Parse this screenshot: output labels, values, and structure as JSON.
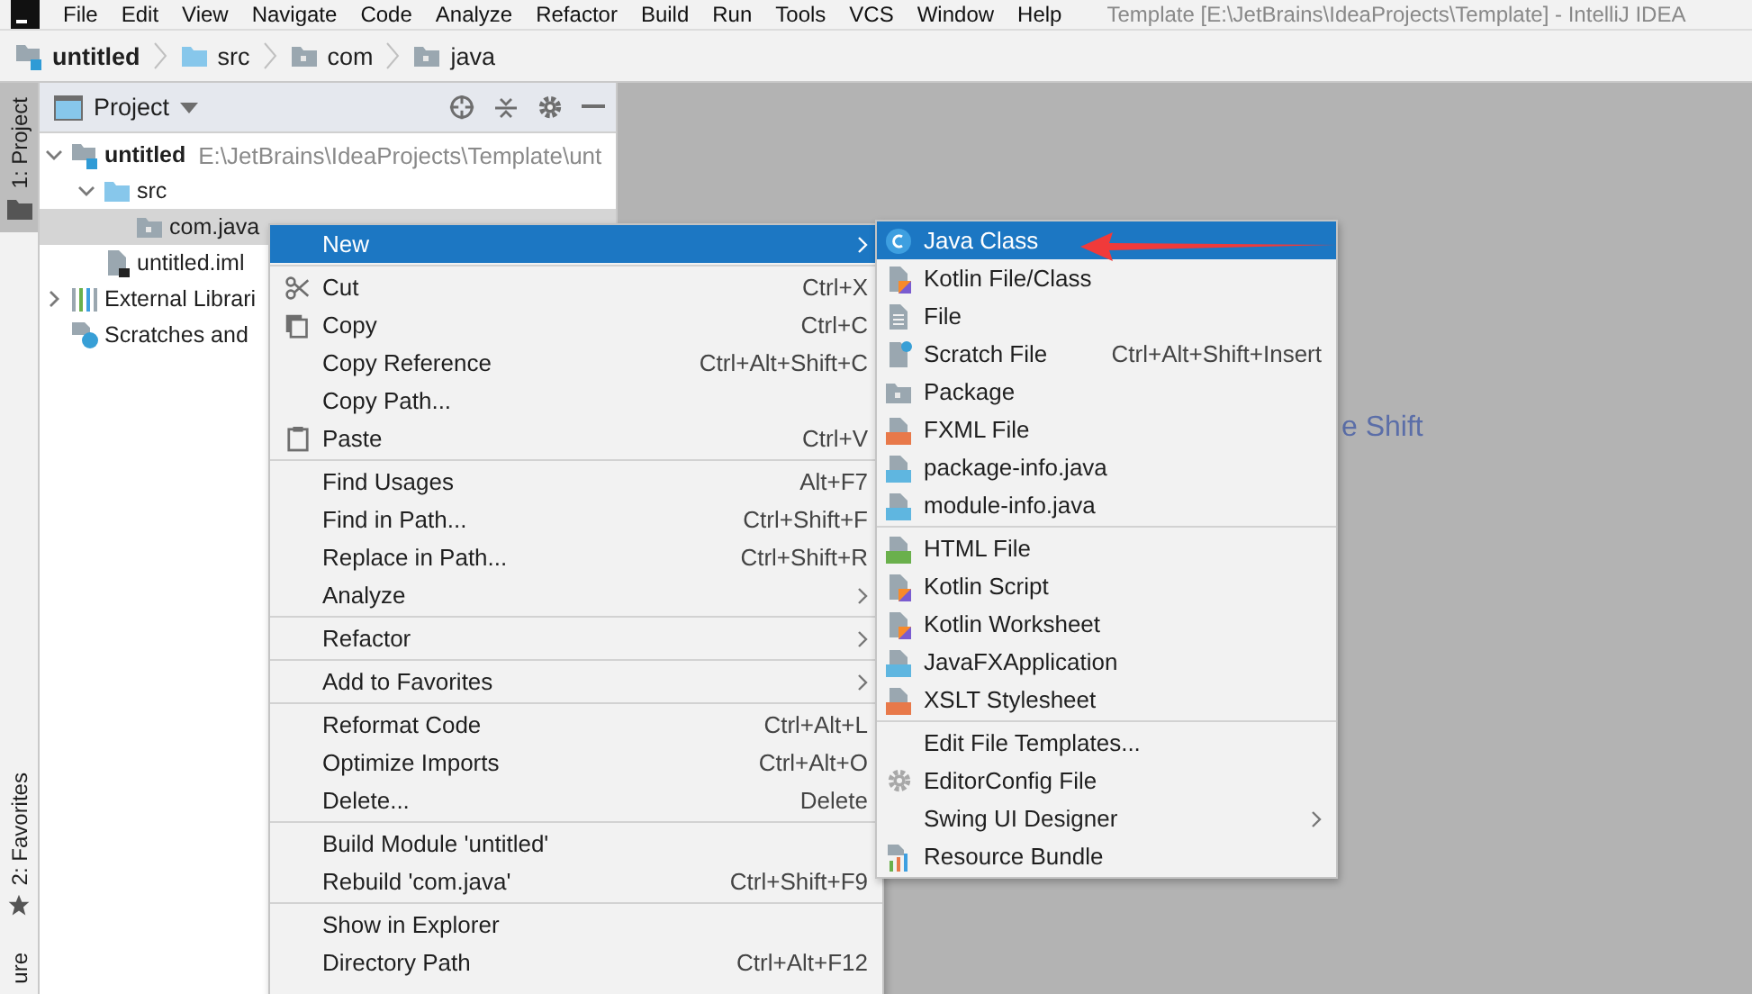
{
  "menu_bar": {
    "items": [
      "File",
      "Edit",
      "View",
      "Navigate",
      "Code",
      "Analyze",
      "Refactor",
      "Build",
      "Run",
      "Tools",
      "VCS",
      "Window",
      "Help"
    ],
    "title": "Template [E:\\JetBrains\\IdeaProjects\\Template] - IntelliJ IDEA"
  },
  "breadcrumbs": [
    {
      "label": "untitled",
      "kind": "module"
    },
    {
      "label": "src",
      "kind": "source"
    },
    {
      "label": "com",
      "kind": "package"
    },
    {
      "label": "java",
      "kind": "package"
    }
  ],
  "tool_stripe": {
    "top": [
      {
        "label": "1: Project",
        "selected": true
      }
    ],
    "bottom": [
      {
        "label": "2: Favorites",
        "selected": false
      },
      {
        "label": "ure",
        "selected": false
      }
    ]
  },
  "project_panel": {
    "title": "Project",
    "tree": [
      {
        "label": "untitled",
        "path": "E:\\JetBrains\\IdeaProjects\\Template\\unt",
        "kind": "module",
        "expanded": true,
        "selected": false,
        "children": [
          {
            "label": "src",
            "kind": "source",
            "expanded": true,
            "selected": false,
            "children": [
              {
                "label": "com.java",
                "kind": "package",
                "selected": true
              }
            ]
          },
          {
            "label": "untitled.iml",
            "kind": "iml",
            "selected": false
          }
        ]
      },
      {
        "label": "External Librari",
        "kind": "libraries",
        "expanded": false,
        "selected": false
      },
      {
        "label": "Scratches and",
        "kind": "scratches",
        "selected": false
      }
    ]
  },
  "editor": {
    "hint": "e Shift"
  },
  "context_menu": {
    "groups": [
      [
        {
          "label": "New",
          "submenu": true,
          "selected": true
        }
      ],
      [
        {
          "label": "Cut",
          "shortcut": "Ctrl+X",
          "selected": false
        },
        {
          "label": "Copy",
          "shortcut": "Ctrl+C",
          "selected": false
        },
        {
          "label": "Copy Reference",
          "shortcut": "Ctrl+Alt+Shift+C",
          "selected": false
        },
        {
          "label": "Copy Path...",
          "selected": false
        },
        {
          "label": "Paste",
          "shortcut": "Ctrl+V",
          "selected": false
        }
      ],
      [
        {
          "label": "Find Usages",
          "shortcut": "Alt+F7",
          "selected": false
        },
        {
          "label": "Find in Path...",
          "shortcut": "Ctrl+Shift+F",
          "selected": false
        },
        {
          "label": "Replace in Path...",
          "shortcut": "Ctrl+Shift+R",
          "selected": false
        },
        {
          "label": "Analyze",
          "submenu": true,
          "selected": false
        }
      ],
      [
        {
          "label": "Refactor",
          "submenu": true,
          "selected": false
        }
      ],
      [
        {
          "label": "Add to Favorites",
          "submenu": true,
          "selected": false
        }
      ],
      [
        {
          "label": "Reformat Code",
          "shortcut": "Ctrl+Alt+L",
          "selected": false
        },
        {
          "label": "Optimize Imports",
          "shortcut": "Ctrl+Alt+O",
          "selected": false
        },
        {
          "label": "Delete...",
          "shortcut": "Delete",
          "selected": false
        }
      ],
      [
        {
          "label": "Build Module 'untitled'",
          "selected": false
        },
        {
          "label": "Rebuild 'com.java'",
          "shortcut": "Ctrl+Shift+F9",
          "selected": false
        }
      ],
      [
        {
          "label": "Show in Explorer",
          "selected": false
        },
        {
          "label": "Directory Path",
          "shortcut": "Ctrl+Alt+F12",
          "selected": false
        }
      ]
    ]
  },
  "new_submenu": {
    "groups": [
      [
        {
          "label": "Java Class",
          "kind": "class",
          "selected": true
        },
        {
          "label": "Kotlin File/Class",
          "kind": "kotlin",
          "selected": false
        },
        {
          "label": "File",
          "kind": "file",
          "selected": false
        },
        {
          "label": "Scratch File",
          "kind": "scratch",
          "shortcut": "Ctrl+Alt+Shift+Insert",
          "selected": false
        },
        {
          "label": "Package",
          "kind": "package",
          "selected": false
        },
        {
          "label": "FXML File",
          "kind": "xml",
          "selected": false
        },
        {
          "label": "package-info.java",
          "kind": "java",
          "selected": false
        },
        {
          "label": "module-info.java",
          "kind": "java",
          "selected": false
        }
      ],
      [
        {
          "label": "HTML File",
          "kind": "html",
          "selected": false
        },
        {
          "label": "Kotlin Script",
          "kind": "kotlin",
          "selected": false
        },
        {
          "label": "Kotlin Worksheet",
          "kind": "kotlin",
          "selected": false
        },
        {
          "label": "JavaFXApplication",
          "kind": "java",
          "selected": false
        },
        {
          "label": "XSLT Stylesheet",
          "kind": "xml",
          "selected": false
        }
      ],
      [
        {
          "label": "Edit File Templates...",
          "kind": "none",
          "selected": false
        },
        {
          "label": "EditorConfig File",
          "kind": "gear",
          "selected": false
        },
        {
          "label": "Swing UI Designer",
          "kind": "none",
          "submenu": true,
          "selected": false
        },
        {
          "label": "Resource Bundle",
          "kind": "bundle",
          "selected": false
        }
      ]
    ]
  }
}
